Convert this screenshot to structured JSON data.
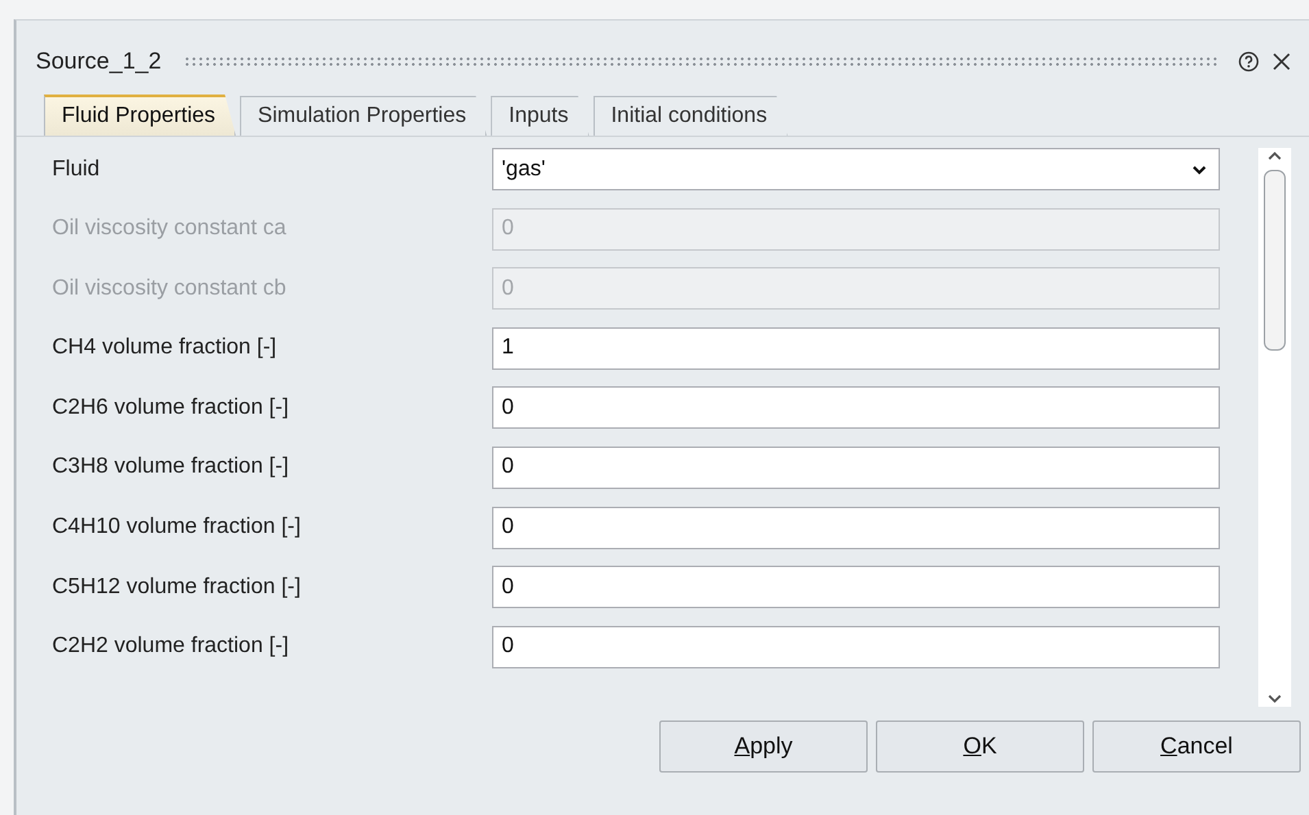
{
  "window": {
    "title": "Source_1_2"
  },
  "tabs": [
    {
      "label": "Fluid Properties",
      "selected": true
    },
    {
      "label": "Simulation Properties",
      "selected": false
    },
    {
      "label": "Inputs",
      "selected": false
    },
    {
      "label": "Initial conditions",
      "selected": false
    }
  ],
  "rows": [
    {
      "label": "Fluid",
      "kind": "dropdown",
      "value": "'gas'",
      "disabled": false
    },
    {
      "label": "Oil viscosity constant ca",
      "kind": "text",
      "value": "0",
      "disabled": true
    },
    {
      "label": "Oil viscosity constant cb",
      "kind": "text",
      "value": "0",
      "disabled": true
    },
    {
      "label": "CH4 volume fraction [-]",
      "kind": "text",
      "value": "1",
      "disabled": false
    },
    {
      "label": "C2H6 volume fraction [-]",
      "kind": "text",
      "value": "0",
      "disabled": false
    },
    {
      "label": "C3H8 volume fraction [-]",
      "kind": "text",
      "value": "0",
      "disabled": false
    },
    {
      "label": "C4H10 volume fraction [-]",
      "kind": "text",
      "value": "0",
      "disabled": false
    },
    {
      "label": "C5H12 volume fraction [-]",
      "kind": "text",
      "value": "0",
      "disabled": false
    },
    {
      "label": "C2H2 volume fraction [-]",
      "kind": "text",
      "value": "0",
      "disabled": false
    }
  ],
  "buttons": [
    {
      "label": "Apply"
    },
    {
      "label": "OK"
    },
    {
      "label": "Cancel"
    }
  ]
}
